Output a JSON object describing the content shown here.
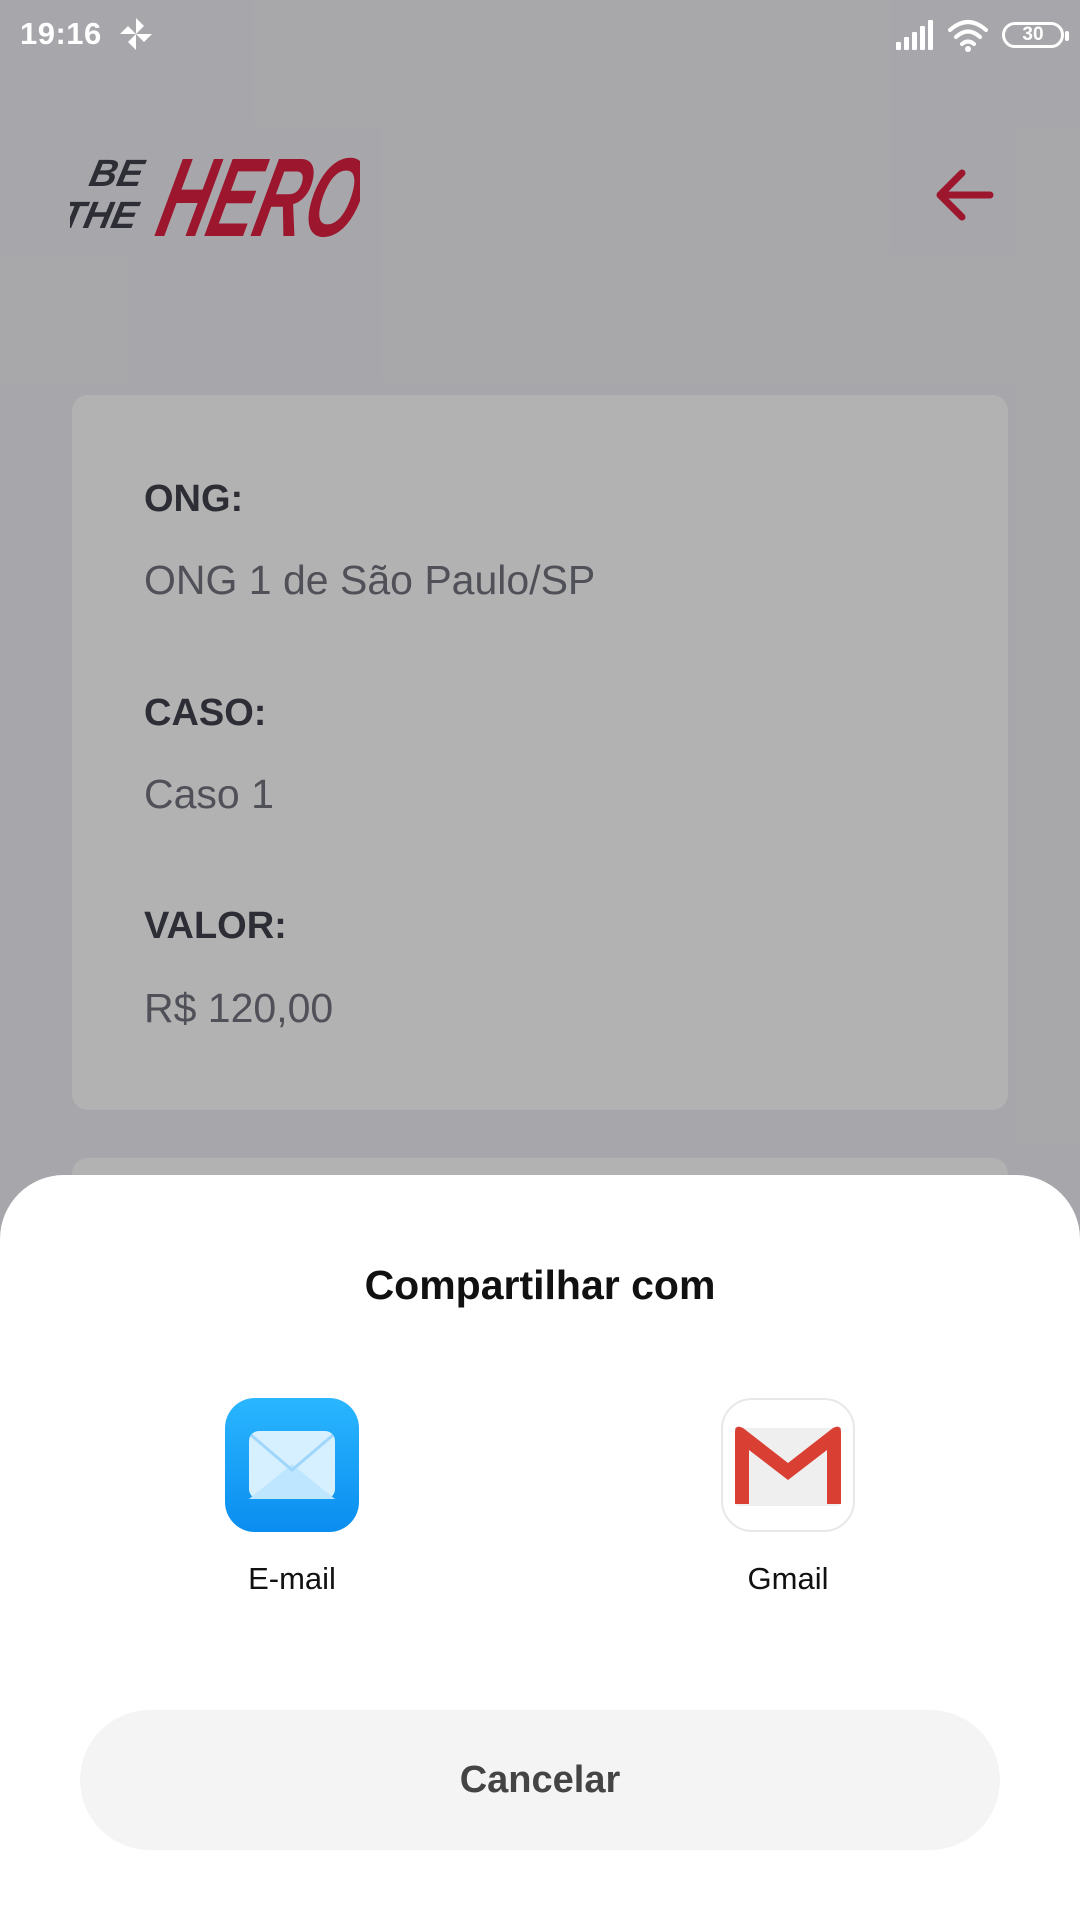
{
  "status_bar": {
    "time": "19:16",
    "battery": "30",
    "icons": [
      "pinwheel-icon",
      "signal-icon",
      "wifi-icon",
      "battery-icon"
    ]
  },
  "header": {
    "logo_text_small_1": "BE",
    "logo_text_small_2": "THE",
    "logo_text_big": "HERO",
    "back_icon": "arrow-left-icon"
  },
  "incident": {
    "ong_label": "ONG:",
    "ong_value": "ONG 1 de São Paulo/SP",
    "case_label": "CASO:",
    "case_value": "Caso 1",
    "value_label": "VALOR:",
    "value_value": "R$ 120,00"
  },
  "share_sheet": {
    "title": "Compartilhar com",
    "targets": [
      {
        "label": "E-mail",
        "icon": "email-app-icon"
      },
      {
        "label": "Gmail",
        "icon": "gmail-app-icon"
      }
    ],
    "cancel_label": "Cancelar"
  },
  "colors": {
    "brand": "#e02041",
    "background": "#f0f0f5",
    "label": "#41414d",
    "value": "#737380"
  }
}
